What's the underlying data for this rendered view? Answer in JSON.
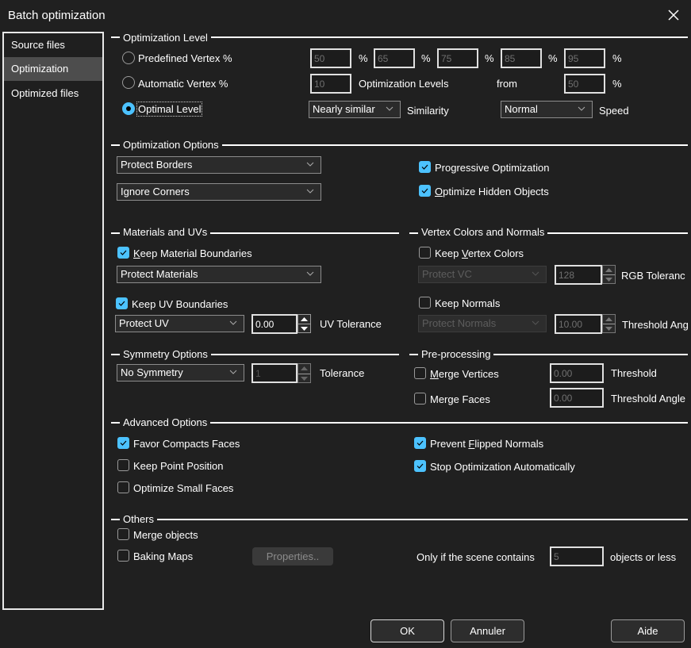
{
  "window": {
    "title": "Batch optimization",
    "close_icon": "close-x-icon"
  },
  "sidebar": {
    "items": [
      {
        "label": "Source files",
        "active": false
      },
      {
        "label": "Optimization",
        "active": true
      },
      {
        "label": "Optimized files",
        "active": false
      }
    ]
  },
  "optimization_level": {
    "title": "Optimization Level",
    "predefined": {
      "label": "Predefined Vertex %",
      "selected": false,
      "values": [
        "50",
        "65",
        "75",
        "85",
        "95"
      ],
      "unit": "%"
    },
    "automatic": {
      "label": "Automatic Vertex %",
      "selected": false,
      "levels": "10",
      "levels_label": "Optimization Levels",
      "from_label": "from",
      "from_value": "50",
      "unit": "%"
    },
    "optimal": {
      "label": "Optimal Level",
      "selected": true,
      "similarity_value": "Nearly similar",
      "similarity_label": "Similarity",
      "speed_value": "Normal",
      "speed_label": "Speed"
    }
  },
  "optimization_options": {
    "title": "Optimization Options",
    "borders_select": "Protect Borders",
    "corners_select": "Ignore Corners",
    "progressive": {
      "label": "Progressive Optimization",
      "checked": true
    },
    "hidden": {
      "label_prefix": "",
      "label_ul": "O",
      "label_rest": "ptimize Hidden Objects",
      "checked": true
    }
  },
  "materials_uvs": {
    "title": "Materials and UVs",
    "keep_material": {
      "label_ul": "K",
      "label_rest": "eep Material Boundaries",
      "checked": true
    },
    "material_select": "Protect Materials",
    "keep_uv": {
      "label": "Keep UV Boundaries",
      "checked": true
    },
    "uv_select": "Protect UV",
    "uv_tolerance_value": "0.00",
    "uv_tolerance_label": "UV Tolerance"
  },
  "vertex_colors_normals": {
    "title": "Vertex Colors and Normals",
    "keep_vc": {
      "label_prefix": "Keep ",
      "label_ul": "V",
      "label_rest": "ertex Colors",
      "checked": false
    },
    "vc_select": "Protect VC",
    "rgb_tolerance_value": "128",
    "rgb_tolerance_label": "RGB Toleranc",
    "keep_normals": {
      "label": "Keep Normals",
      "checked": false
    },
    "normals_select": "Protect Normals",
    "threshold_angle_value": "10.00",
    "threshold_angle_label": "Threshold Ang"
  },
  "symmetry": {
    "title": "Symmetry Options",
    "select": "No Symmetry",
    "tolerance_value": "1",
    "tolerance_label": "Tolerance"
  },
  "preprocessing": {
    "title": "Pre-processing",
    "merge_vertices": {
      "label_ul": "M",
      "label_rest": "erge Vertices",
      "checked": false,
      "value": "0.00",
      "value_label": "Threshold"
    },
    "merge_faces": {
      "label": "Merge Faces",
      "checked": false,
      "value": "0.00",
      "value_label": "Threshold Angle"
    }
  },
  "advanced": {
    "title": "Advanced Options",
    "favor_compact": {
      "label": "Favor Compacts Faces",
      "checked": true
    },
    "keep_point": {
      "label": "Keep Point Position",
      "checked": false
    },
    "optimize_small": {
      "label": "Optimize Small Faces",
      "checked": false
    },
    "prevent_flipped": {
      "label_prefix": "Prevent ",
      "label_ul": "F",
      "label_rest": "lipped Normals",
      "checked": true
    },
    "stop_auto": {
      "label": "Stop Optimization Automatically",
      "checked": true
    }
  },
  "others": {
    "title": "Others",
    "merge_objects": {
      "label": "Merge objects",
      "checked": false
    },
    "baking_maps": {
      "label": "Baking Maps",
      "checked": false
    },
    "properties_button": "Properties..",
    "only_if_label": "Only if the scene contains",
    "objects_value": "5",
    "objects_suffix": "objects or less"
  },
  "footer": {
    "ok": "OK",
    "cancel": "Annuler",
    "help": "Aide"
  },
  "colors": {
    "accent": "#4cc2ff",
    "background": "#202020",
    "sidebar_active": "#4d4d4d"
  }
}
